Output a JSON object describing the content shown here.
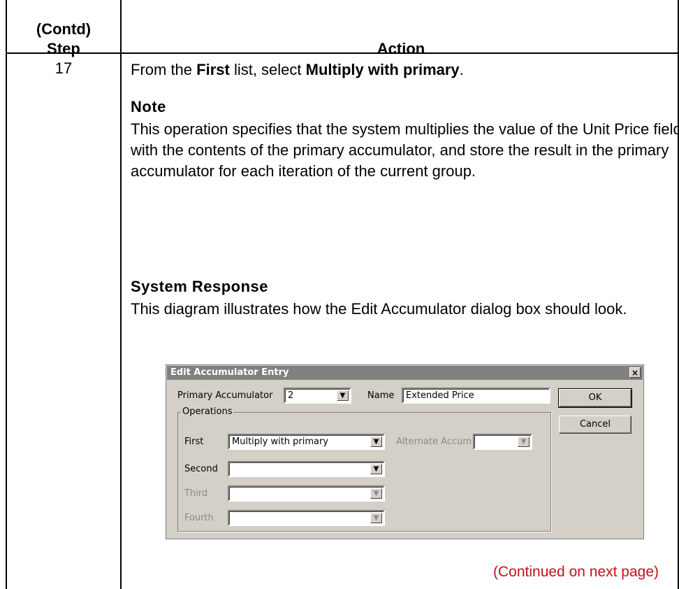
{
  "table": {
    "header_step": [
      "(Contd)",
      "Step"
    ],
    "header_action": "Action",
    "step_number": "17"
  },
  "content": {
    "intro_prefix": "From the ",
    "intro_bold1": "First",
    "intro_mid": " list, select ",
    "intro_bold2": "Multiply with primary",
    "intro_suffix": ".",
    "note_heading": "Note",
    "note_text": "This operation specifies that the system multiplies the value of the Unit Price field with the contents of the primary accumulator, and store the result in the primary accumulator for each iteration of the current group.",
    "response_heading": "System Response",
    "response_text": "This diagram illustrates how the Edit Accumulator dialog box should look.",
    "continued": "(Continued on next page)"
  },
  "dialog": {
    "title": "Edit Accumulator Entry",
    "close_glyph": "×",
    "primary_label": "Primary Accumulator",
    "primary_value": "2",
    "name_label": "Name",
    "name_value": "Extended Price",
    "ok_label": "OK",
    "cancel_label": "Cancel",
    "operations_label": "Operations",
    "first_label": "First",
    "first_value": "Multiply with primary",
    "alternate_label": "Alternate Accum",
    "second_label": "Second",
    "third_label": "Third",
    "fourth_label": "Fourth",
    "dropdown_glyph": "▼"
  }
}
